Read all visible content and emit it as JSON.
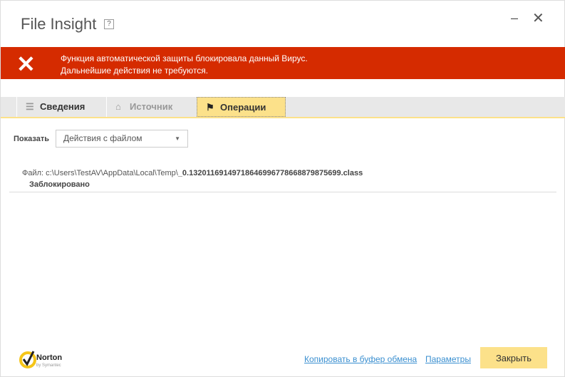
{
  "window": {
    "title": "File Insight",
    "help": "?",
    "minimize": "–",
    "close": "✕"
  },
  "banner": {
    "icon": "✕",
    "line1": "Функция автоматической защиты блокировала данный Вирус.",
    "line2": "Дальнейшие действия не требуются.",
    "color": "#d52b00"
  },
  "tabs": [
    {
      "label": "Сведения",
      "icon": "list-icon"
    },
    {
      "label": "Источник",
      "icon": "home-icon"
    },
    {
      "label": "Операции",
      "icon": "flag-icon",
      "active": true
    }
  ],
  "filter": {
    "label": "Показать",
    "value": "Действия с файлом"
  },
  "entry": {
    "prefix": "Файл: c:\\Users\\TestAV\\AppData\\Local\\Temp\\",
    "filename": "_0.13201169149718646996778668879875699.class",
    "status": "Заблокировано"
  },
  "footer": {
    "logo": "Norton by Symantec",
    "copy_link": "Копировать в буфер обмена",
    "settings_link": "Параметры",
    "close_button": "Закрыть"
  }
}
